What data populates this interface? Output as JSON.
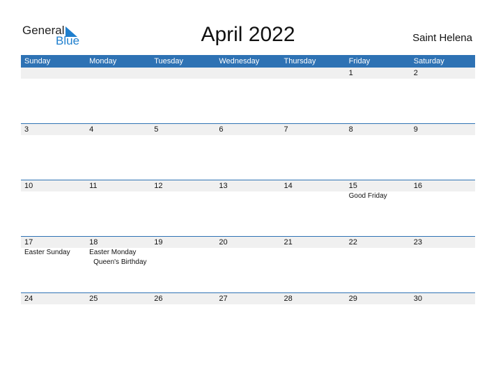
{
  "logo": {
    "general": "General",
    "blue": "Blue"
  },
  "title": "April 2022",
  "country": "Saint Helena",
  "days": [
    "Sunday",
    "Monday",
    "Tuesday",
    "Wednesday",
    "Thursday",
    "Friday",
    "Saturday"
  ],
  "weeks": [
    {
      "dates": [
        "",
        "",
        "",
        "",
        "",
        "1",
        "2"
      ],
      "holidays": [
        "",
        "",
        "",
        "",
        "",
        "",
        ""
      ]
    },
    {
      "dates": [
        "3",
        "4",
        "5",
        "6",
        "7",
        "8",
        "9"
      ],
      "holidays": [
        "",
        "",
        "",
        "",
        "",
        "",
        ""
      ]
    },
    {
      "dates": [
        "10",
        "11",
        "12",
        "13",
        "14",
        "15",
        "16"
      ],
      "holidays": [
        "",
        "",
        "",
        "",
        "",
        "Good Friday",
        ""
      ]
    },
    {
      "dates": [
        "17",
        "18",
        "19",
        "20",
        "21",
        "22",
        "23"
      ],
      "holidays": [
        "Easter Sunday",
        "Easter Monday",
        "",
        "",
        "",
        "",
        ""
      ],
      "holidays2": [
        "",
        "Queen's Birthday",
        "",
        "",
        "",
        "",
        ""
      ]
    },
    {
      "dates": [
        "24",
        "25",
        "26",
        "27",
        "28",
        "29",
        "30"
      ],
      "holidays": [
        "",
        "",
        "",
        "",
        "",
        "",
        ""
      ]
    }
  ]
}
